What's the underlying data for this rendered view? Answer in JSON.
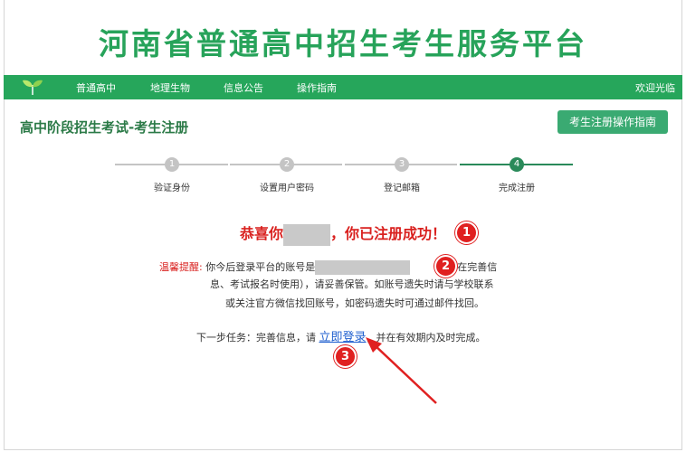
{
  "site": {
    "title": "河南省普通高中招生考生服务平台"
  },
  "nav": {
    "items": [
      "普通高中",
      "地理生物",
      "信息公告",
      "操作指南"
    ],
    "welcome": "欢迎光临"
  },
  "page": {
    "heading": "高中阶段招生考试-考生注册",
    "guide_button": "考生注册操作指南"
  },
  "steps": [
    {
      "num": "1",
      "label": "验证身份"
    },
    {
      "num": "2",
      "label": "设置用户密码"
    },
    {
      "num": "3",
      "label": "登记邮箱"
    },
    {
      "num": "4",
      "label": "完成注册"
    }
  ],
  "success": {
    "prefix": "恭喜你",
    "suffix": "，你已注册成功！"
  },
  "reminder": {
    "tip_label": "温馨提醒:",
    "part1": "你今后登录平台的账号是",
    "part2": "号将在完善信",
    "line2": "息、考试报名时使用），请妥善保管。如账号遗失时请与学校联系",
    "line3": "或关注官方微信找回账号，如密码遗失时可通过邮件找回。"
  },
  "next_step": {
    "prefix": "下一步任务：完善信息，请",
    "link": "立即登录",
    "suffix": "，并在有效期内及时完成。"
  },
  "annotations": [
    "1",
    "2",
    "3"
  ],
  "colors": {
    "brand_green": "#26a65b",
    "alert_red": "#d9211f",
    "link_blue": "#1f5fcf"
  }
}
